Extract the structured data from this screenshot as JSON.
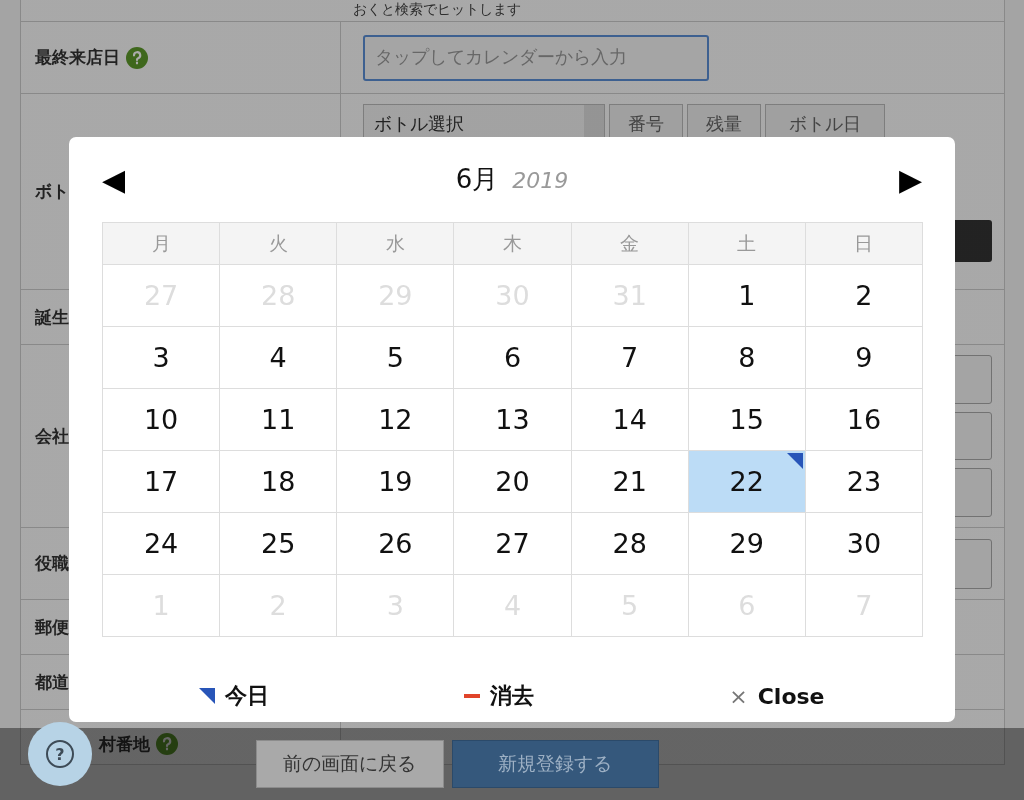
{
  "form": {
    "note": "おくと検索でヒットします",
    "rows": [
      {
        "kind": "date",
        "label": "最終来店日",
        "help": true,
        "placeholder": "タップしてカレンダーから入力"
      },
      {
        "kind": "bottle",
        "label": "ボト",
        "select": "ボトル選択",
        "buttons": [
          "番号",
          "残量",
          "ボトル日"
        ]
      },
      {
        "kind": "plain",
        "label": "誕生"
      },
      {
        "kind": "triple",
        "label": "会社"
      },
      {
        "kind": "single",
        "label": "役職"
      },
      {
        "kind": "plain",
        "label": "郵便"
      },
      {
        "kind": "plain",
        "label": "都道"
      },
      {
        "kind": "plain",
        "label": "村番地",
        "help": true
      }
    ]
  },
  "calendar": {
    "month": "6月",
    "year": "2019",
    "prev": "◀",
    "next": "▶",
    "weekdays": [
      "月",
      "火",
      "水",
      "木",
      "金",
      "土",
      "日"
    ],
    "days": [
      {
        "label": "27",
        "outside": true,
        "selected": false,
        "today": false
      },
      {
        "label": "28",
        "outside": true,
        "selected": false,
        "today": false
      },
      {
        "label": "29",
        "outside": true,
        "selected": false,
        "today": false
      },
      {
        "label": "30",
        "outside": true,
        "selected": false,
        "today": false
      },
      {
        "label": "31",
        "outside": true,
        "selected": false,
        "today": false
      },
      {
        "label": "1",
        "outside": false,
        "selected": false,
        "today": false
      },
      {
        "label": "2",
        "outside": false,
        "selected": false,
        "today": false
      },
      {
        "label": "3",
        "outside": false,
        "selected": false,
        "today": false
      },
      {
        "label": "4",
        "outside": false,
        "selected": false,
        "today": false
      },
      {
        "label": "5",
        "outside": false,
        "selected": false,
        "today": false
      },
      {
        "label": "6",
        "outside": false,
        "selected": false,
        "today": false
      },
      {
        "label": "7",
        "outside": false,
        "selected": false,
        "today": false
      },
      {
        "label": "8",
        "outside": false,
        "selected": false,
        "today": false
      },
      {
        "label": "9",
        "outside": false,
        "selected": false,
        "today": false
      },
      {
        "label": "10",
        "outside": false,
        "selected": false,
        "today": false
      },
      {
        "label": "11",
        "outside": false,
        "selected": false,
        "today": false
      },
      {
        "label": "12",
        "outside": false,
        "selected": false,
        "today": false
      },
      {
        "label": "13",
        "outside": false,
        "selected": false,
        "today": false
      },
      {
        "label": "14",
        "outside": false,
        "selected": false,
        "today": false
      },
      {
        "label": "15",
        "outside": false,
        "selected": false,
        "today": false
      },
      {
        "label": "16",
        "outside": false,
        "selected": false,
        "today": false
      },
      {
        "label": "17",
        "outside": false,
        "selected": false,
        "today": false
      },
      {
        "label": "18",
        "outside": false,
        "selected": false,
        "today": false
      },
      {
        "label": "19",
        "outside": false,
        "selected": false,
        "today": false
      },
      {
        "label": "20",
        "outside": false,
        "selected": false,
        "today": false
      },
      {
        "label": "21",
        "outside": false,
        "selected": false,
        "today": false
      },
      {
        "label": "22",
        "outside": false,
        "selected": true,
        "today": true
      },
      {
        "label": "23",
        "outside": false,
        "selected": false,
        "today": false
      },
      {
        "label": "24",
        "outside": false,
        "selected": false,
        "today": false
      },
      {
        "label": "25",
        "outside": false,
        "selected": false,
        "today": false
      },
      {
        "label": "26",
        "outside": false,
        "selected": false,
        "today": false
      },
      {
        "label": "27",
        "outside": false,
        "selected": false,
        "today": false
      },
      {
        "label": "28",
        "outside": false,
        "selected": false,
        "today": false
      },
      {
        "label": "29",
        "outside": false,
        "selected": false,
        "today": false
      },
      {
        "label": "30",
        "outside": false,
        "selected": false,
        "today": false
      },
      {
        "label": "1",
        "outside": true,
        "selected": false,
        "today": false
      },
      {
        "label": "2",
        "outside": true,
        "selected": false,
        "today": false
      },
      {
        "label": "3",
        "outside": true,
        "selected": false,
        "today": false
      },
      {
        "label": "4",
        "outside": true,
        "selected": false,
        "today": false
      },
      {
        "label": "5",
        "outside": true,
        "selected": false,
        "today": false
      },
      {
        "label": "6",
        "outside": true,
        "selected": false,
        "today": false
      },
      {
        "label": "7",
        "outside": true,
        "selected": false,
        "today": false
      }
    ],
    "actions": [
      {
        "kind": "today",
        "label": "今日"
      },
      {
        "kind": "clear",
        "label": "消去"
      },
      {
        "kind": "close",
        "icon": "×",
        "label": "Close"
      }
    ]
  },
  "bottom_bar": {
    "back": "前の画面に戻る",
    "submit": "新規登録する",
    "help": "?"
  }
}
